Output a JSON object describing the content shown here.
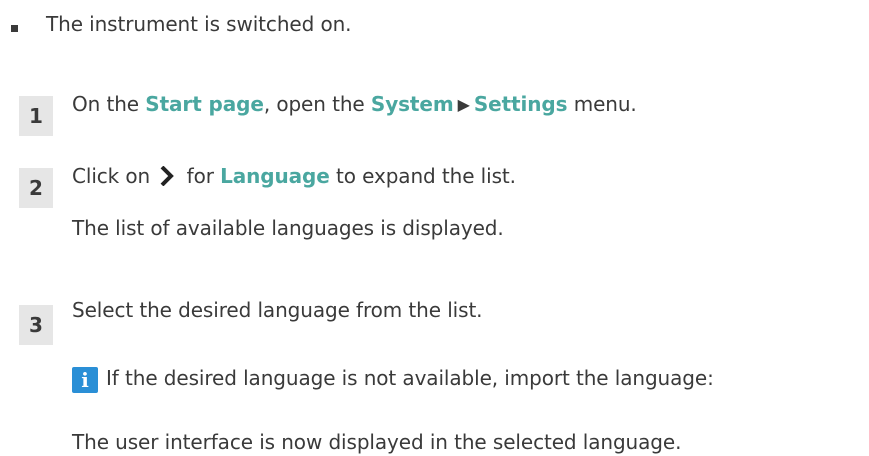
{
  "prerequisite": {
    "text": "The instrument is switched on."
  },
  "steps": [
    {
      "number": "1",
      "parts": {
        "a": "On the ",
        "b": "Start page",
        "c": ", open the ",
        "d": "System",
        "e": "Settings",
        "f": " menu."
      }
    },
    {
      "number": "2",
      "parts": {
        "a": "Click on ",
        "b": " for ",
        "c": "Language",
        "d": " to expand the list."
      },
      "result": "The list of available languages is displayed."
    },
    {
      "number": "3",
      "text": "Select the desired language from the list.",
      "note": "If the desired language is not available, import the language:",
      "result": "The user interface is now displayed in the selected language."
    }
  ],
  "icons": {
    "bullet": "square-bullet-icon",
    "menu_arrow": "right-triangle-icon",
    "expand": "chevron-right-icon",
    "info": "info-icon",
    "info_letter": "i",
    "info_color": "#2a8fd6",
    "highlight_color": "#4aa7a0"
  }
}
